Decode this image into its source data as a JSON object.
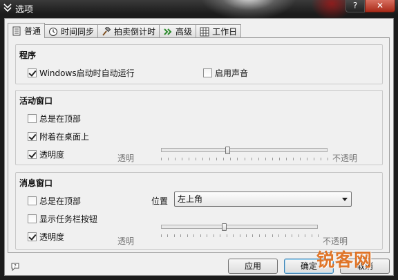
{
  "window": {
    "title": "选项",
    "help_label": "?",
    "close_label": "✕"
  },
  "tabs": [
    {
      "label": "普通",
      "icon": "document-icon",
      "active": true
    },
    {
      "label": "时间同步",
      "icon": "clock-icon",
      "active": false
    },
    {
      "label": "拍卖倒计时",
      "icon": "gavel-icon",
      "active": false
    },
    {
      "label": "高级",
      "icon": "double-chevron-icon",
      "active": false
    },
    {
      "label": "工作日",
      "icon": "calendar-grid-icon",
      "active": false
    }
  ],
  "program": {
    "title": "程序",
    "autostart": {
      "label": "Windows启动时自动运行",
      "checked": true
    },
    "sound": {
      "label": "启用声音",
      "checked": false
    }
  },
  "active_window": {
    "title": "活动窗口",
    "always_on_top": {
      "label": "总是在顶部",
      "checked": false
    },
    "attach_desktop": {
      "label": "附着在桌面上",
      "checked": true
    },
    "transparency": {
      "label": "透明度",
      "checked": true
    },
    "slider_min_label": "透明",
    "slider_max_label": "不透明",
    "slider_value": 0.4
  },
  "message_window": {
    "title": "消息窗口",
    "always_on_top": {
      "label": "总是在顶部",
      "checked": false
    },
    "show_taskbar": {
      "label": "显示任务栏按钮",
      "checked": false
    },
    "transparency": {
      "label": "透明度",
      "checked": true
    },
    "position_label": "位置",
    "position_value": "左上角",
    "slider_min_label": "透明",
    "slider_max_label": "不透明",
    "slider_value": 0.4
  },
  "buttons": {
    "apply": "应用",
    "ok": "确定",
    "cancel": "取消"
  },
  "watermark": "锐客网"
}
